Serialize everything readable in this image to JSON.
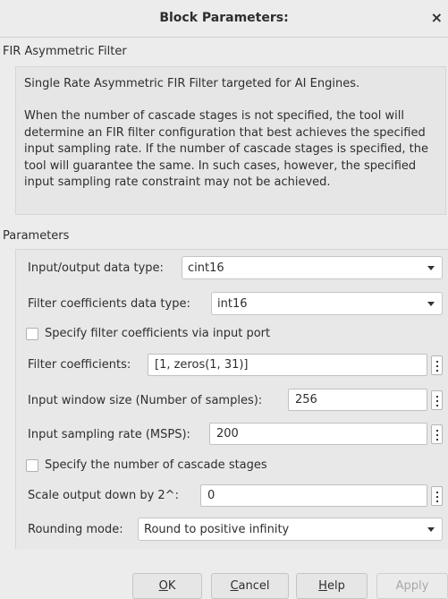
{
  "window": {
    "title": "Block Parameters:",
    "close_glyph": "×"
  },
  "block": {
    "name": "FIR Asymmetric Filter",
    "description_1": "Single Rate Asymmetric FIR Filter targeted for AI Engines.",
    "description_2": "When the number of cascade stages is not specified, the tool will determine an FIR filter configuration that best achieves the specified input sampling rate. If the number of cascade stages is specified, the tool will guarantee the same. In such cases, however, the specified input sampling rate constraint may not be achieved."
  },
  "params": {
    "section_label": "Parameters",
    "io_type_label": "Input/output data type:",
    "io_type_value": "cint16",
    "coef_type_label": "Filter coefficients data type:",
    "coef_type_value": "int16",
    "coef_port_label": "Specify filter coefficients via input port",
    "coef_label": "Filter coefficients:",
    "coef_value": "[1, zeros(1, 31)]",
    "window_label": "Input window size (Number of samples):",
    "window_value": "256",
    "rate_label": "Input sampling rate (MSPS):",
    "rate_value": "200",
    "cascade_label": "Specify the number of cascade stages",
    "scale_label": "Scale output down by 2^:",
    "scale_value": "0",
    "rounding_label": "Rounding mode:",
    "rounding_value": "Round to positive infinity"
  },
  "buttons": {
    "ok_mnemonic": "O",
    "ok_rest": "K",
    "cancel_mnemonic": "C",
    "cancel_rest": "ancel",
    "help_mnemonic": "H",
    "help_rest": "elp",
    "apply_label": "Apply"
  },
  "icons": [
    "close-icon",
    "dropdown-arrow-icon",
    "more-options-icon",
    "checkbox"
  ]
}
